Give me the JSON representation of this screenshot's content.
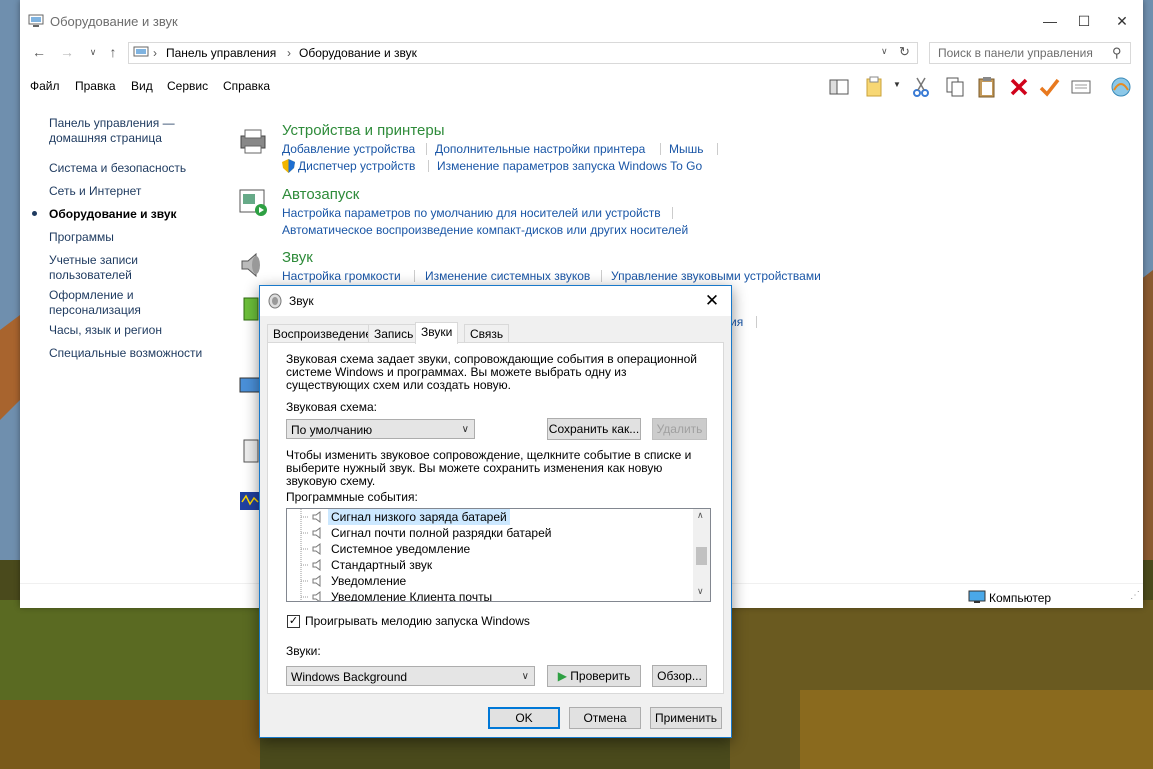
{
  "window": {
    "title": "Оборудование и звук",
    "minimize": "—",
    "maximize": "☐",
    "close": "✕"
  },
  "address": {
    "crumbs": [
      "Панель управления",
      "Оборудование и звук"
    ],
    "separator": "›",
    "search_placeholder": "Поиск в панели управления"
  },
  "menu": [
    "Файл",
    "Правка",
    "Вид",
    "Сервис",
    "Справка"
  ],
  "sidebar": [
    {
      "label": "Панель управления — домашняя страница",
      "active": false
    },
    {
      "label": "Система и безопасность",
      "active": false
    },
    {
      "label": "Сеть и Интернет",
      "active": false
    },
    {
      "label": "Оборудование и звук",
      "active": true
    },
    {
      "label": "Программы",
      "active": false
    },
    {
      "label": "Учетные записи пользователей",
      "active": false
    },
    {
      "label": "Оформление и персонализация",
      "active": false
    },
    {
      "label": "Часы, язык и регион",
      "active": false
    },
    {
      "label": "Специальные возможности",
      "active": false
    }
  ],
  "categories": [
    {
      "title": "Устройства и принтеры",
      "links": [
        "Добавление устройства",
        "Дополнительные настройки принтера",
        "Мышь",
        "Диспетчер устройств",
        "Изменение параметров запуска Windows To Go"
      ]
    },
    {
      "title": "Автозапуск",
      "links": [
        "Настройка параметров по умолчанию для носителей или устройств",
        "Автоматическое воспроизведение компакт-дисков или других носителей"
      ]
    },
    {
      "title": "Звук",
      "links": [
        "Настройка громкости",
        "Изменение системных звуков",
        "Управление звуковыми устройствами"
      ]
    }
  ],
  "partial_link": "ия",
  "status": {
    "computer": "Компьютер"
  },
  "dialog": {
    "title": "Звук",
    "close": "✕",
    "tabs": [
      "Воспроизведение",
      "Запись",
      "Звуки",
      "Связь"
    ],
    "selected_tab": 2,
    "description": "Звуковая схема задает звуки, сопровождающие события в операционной системе Windows и программах. Вы можете выбрать одну из существующих схем или создать новую.",
    "scheme_label": "Звуковая схема:",
    "scheme_value": "По умолчанию",
    "save_as": "Сохранить как...",
    "delete": "Удалить",
    "instruction": "Чтобы изменить звуковое сопровождение, щелкните событие в списке и выберите нужный звук. Вы можете сохранить изменения как новую звуковую схему.",
    "events_label": "Программные события:",
    "events": [
      {
        "label": "Сигнал низкого заряда батарей",
        "selected": true
      },
      {
        "label": "Сигнал почти полной разрядки батарей",
        "selected": false
      },
      {
        "label": "Системное уведомление",
        "selected": false
      },
      {
        "label": "Стандартный звук",
        "selected": false
      },
      {
        "label": "Уведомление",
        "selected": false
      },
      {
        "label": "Уведомление Клиента почты",
        "selected": false
      }
    ],
    "startup_checkbox": {
      "label": "Проигрывать мелодию запуска Windows",
      "checked": true
    },
    "sounds_label": "Звуки:",
    "sound_value": "Windows Background",
    "test": "Проверить",
    "browse": "Обзор...",
    "ok": "OK",
    "cancel": "Отмена",
    "apply": "Применить"
  },
  "colors": {
    "link": "#1a56a6",
    "category_title": "#2e8b3a",
    "dialog_border": "#1979ca",
    "selection": "#cce8ff"
  }
}
